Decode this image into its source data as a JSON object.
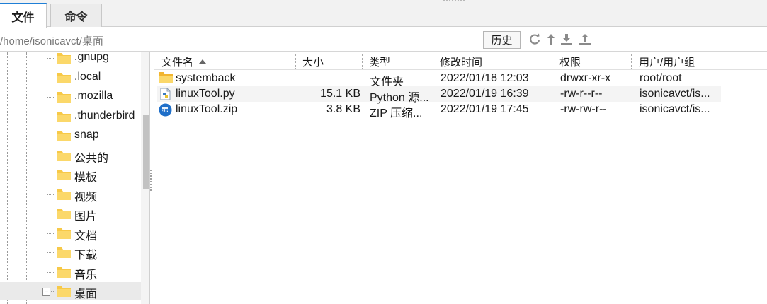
{
  "tabs": [
    {
      "label": "文件",
      "active": true
    },
    {
      "label": "命令",
      "active": false
    }
  ],
  "path_bar": {
    "path": "/home/isonicavct/桌面",
    "history_label": "历史",
    "icons": [
      "refresh-icon",
      "go-up-icon",
      "download-icon",
      "upload-icon"
    ]
  },
  "tree": {
    "items": [
      {
        "label": ".gnupg"
      },
      {
        "label": ".local"
      },
      {
        "label": ".mozilla"
      },
      {
        "label": ".thunderbird"
      },
      {
        "label": "snap"
      },
      {
        "label": "公共的"
      },
      {
        "label": "模板"
      },
      {
        "label": "视频"
      },
      {
        "label": "图片"
      },
      {
        "label": "文档"
      },
      {
        "label": "下载"
      },
      {
        "label": "音乐"
      },
      {
        "label": "桌面",
        "selected": true,
        "expanded": true
      }
    ]
  },
  "file_list": {
    "columns": [
      "文件名",
      "大小",
      "类型",
      "修改时间",
      "权限",
      "用户/用户组"
    ],
    "sort_column": "文件名",
    "sort_direction": "ascending",
    "rows": [
      {
        "name": "systemback",
        "size": "",
        "type": "文件夹",
        "modified": "2022/01/18 12:03",
        "perms": "drwxr-xr-x",
        "owner": "root/root",
        "icon": "folder-icon"
      },
      {
        "name": "linuxTool.py",
        "size": "15.1 KB",
        "type": "Python 源...",
        "modified": "2022/01/19 16:39",
        "perms": "-rw-r--r--",
        "owner": "isonicavct/is...",
        "icon": "python-file-icon"
      },
      {
        "name": "linuxTool.zip",
        "size": "3.8 KB",
        "type": "ZIP 压缩...",
        "modified": "2022/01/19 17:45",
        "perms": "-rw-rw-r--",
        "owner": "isonicavct/is...",
        "icon": "zip-file-icon"
      }
    ]
  },
  "colors": {
    "accent": "#1f7fd6",
    "folder": "#f7c948",
    "selection": "#eaeaea"
  }
}
